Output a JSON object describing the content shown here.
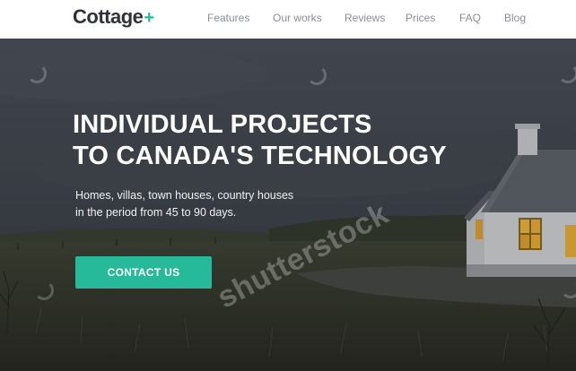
{
  "header": {
    "logo_text": "Cottage",
    "logo_symbol": "+",
    "nav": [
      {
        "label": "Features"
      },
      {
        "label": "Our works"
      },
      {
        "label": "Reviews"
      },
      {
        "label": "Prices"
      },
      {
        "label": "FAQ"
      },
      {
        "label": "Blog"
      }
    ]
  },
  "hero": {
    "headline_line1": "INDIVIDUAL PROJECTS",
    "headline_line2": "TO CANADA'S TECHNOLOGY",
    "subtext_line1": "Homes, villas, town houses, country houses",
    "subtext_line2": "in the period from 45 to 90 days.",
    "cta_label": "CONTACT US",
    "watermark": "shutterstock"
  },
  "colors": {
    "accent": "#26b99a",
    "header_bg": "#ffffff",
    "nav_text": "#8a8f96",
    "logo_text": "#2f3338"
  }
}
